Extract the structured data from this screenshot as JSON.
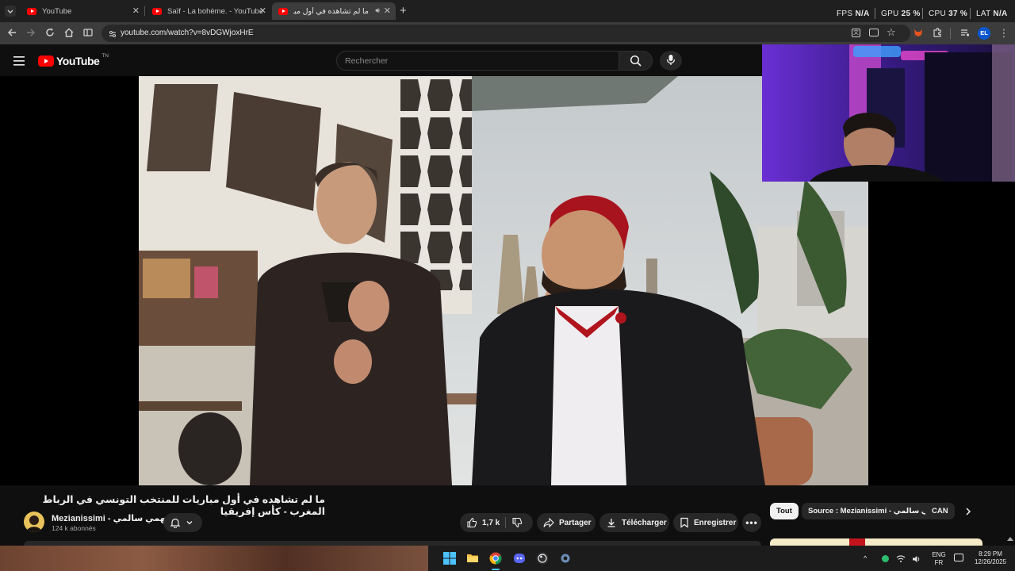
{
  "browser": {
    "tabs": [
      {
        "label": "YouTube",
        "active": false
      },
      {
        "label": "Saïf - La bohème. - YouTube",
        "active": false
      },
      {
        "label": "ما لم تشاهده في أول مباريات",
        "active": true
      }
    ],
    "url": "youtube.com/watch?v=8vDGWjoxHrE",
    "profile_initials": "EL"
  },
  "overlay_stats": {
    "fps_label": "FPS",
    "fps_value": "N/A",
    "gpu_label": "GPU",
    "gpu_value": "25 %",
    "cpu_label": "CPU",
    "cpu_value": "37 %",
    "lat_label": "LAT",
    "lat_value": "N/A"
  },
  "youtube": {
    "logo_text": "YouTube",
    "logo_region": "TN",
    "search_placeholder": "Rechercher"
  },
  "video": {
    "title": "ما لم تشاهده في أول مباريات للمنتخب التونسي في الرباط المغرب - كأس إفريقيا",
    "channel_name": "Mezianissimi - فهمي سالمي",
    "subscribers": "124 k abonnés",
    "likes": "1,7 k",
    "actions": {
      "share": "Partager",
      "download": "Télécharger",
      "save": "Enregistrer"
    }
  },
  "chips": [
    "Tout",
    "Source : Mezianissimi - فهمي سالمي",
    "CAN"
  ],
  "taskbar": {
    "lang_top": "ENG",
    "lang_bottom": "FR",
    "time": "8:29 PM",
    "date": "12/26/2025"
  },
  "colors": {
    "youtube_red": "#ff0000",
    "page_bg": "#0f0f0f",
    "pill_bg": "#272727"
  }
}
